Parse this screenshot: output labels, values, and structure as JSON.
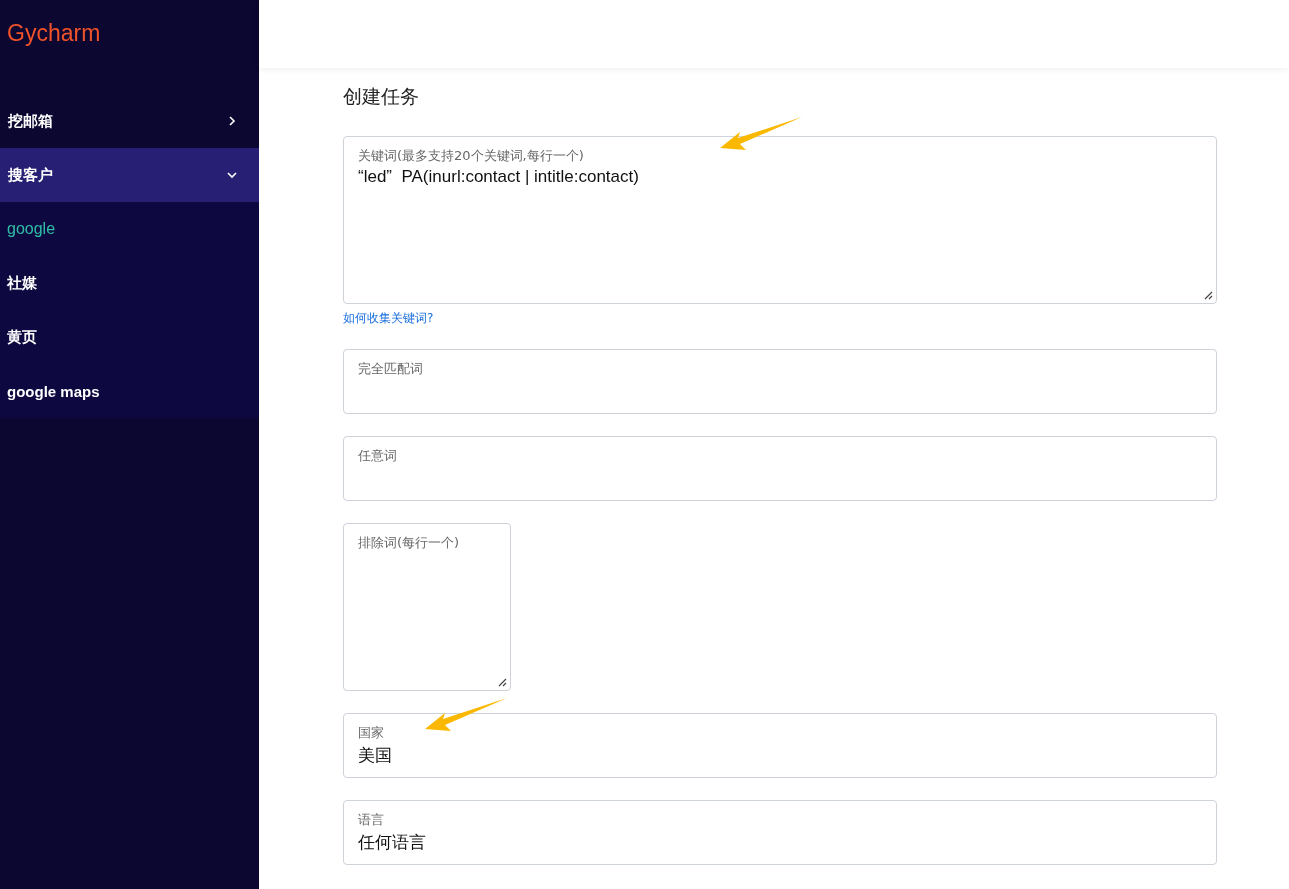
{
  "brand": "Gycharm",
  "sidebar": {
    "items": [
      {
        "label": "挖邮箱",
        "expanded": false
      },
      {
        "label": "搜客户",
        "expanded": true,
        "children": [
          {
            "label": "google",
            "selected": true
          },
          {
            "label": "社媒",
            "selected": false
          },
          {
            "label": "黄页",
            "selected": false
          },
          {
            "label": "google maps",
            "selected": false
          }
        ]
      }
    ]
  },
  "page_title": "创建任务",
  "fields": [
    {
      "kind": "textarea",
      "label": "关键词(最多支持20个关键词,每行一个)",
      "value": "“led”  PA(inurl:contact | intitle:contact)",
      "help_link": "如何收集关键词?",
      "arrow": true
    },
    {
      "kind": "input",
      "label": "完全匹配词",
      "arrow": false
    },
    {
      "kind": "input",
      "label": "任意词",
      "arrow": false
    },
    {
      "kind": "small-textarea",
      "label": "排除词(每行一个)",
      "arrow": false
    },
    {
      "kind": "input",
      "label": "国家",
      "value": "美国",
      "arrow": true
    },
    {
      "kind": "input",
      "label": "语言",
      "value": "任何语言",
      "arrow": false
    }
  ]
}
